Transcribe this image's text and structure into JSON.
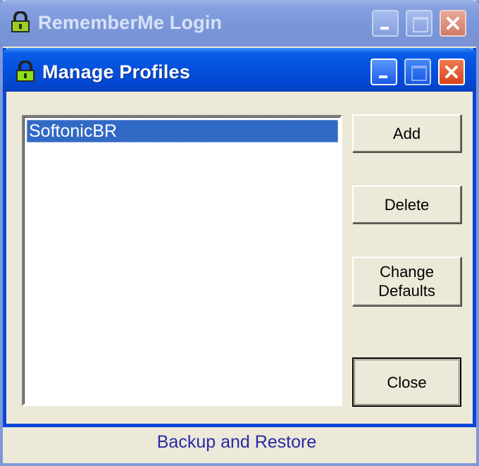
{
  "outer_window": {
    "title": "RememberMe Login",
    "icon": "lock-icon"
  },
  "dialog": {
    "title": "Manage Profiles",
    "icon": "lock-icon"
  },
  "profiles": {
    "items": [
      "SoftonicBR"
    ],
    "selected": "SoftonicBR"
  },
  "buttons": {
    "add": "Add",
    "delete": "Delete",
    "change_defaults_line1": "Change",
    "change_defaults_line2": "Defaults",
    "close": "Close"
  },
  "footer": {
    "link": "Backup and Restore"
  },
  "colors": {
    "titlebar_active": "#0450dc",
    "titlebar_inactive": "#7a96d8",
    "selection": "#316ac5",
    "footer_link": "#2a2aa8"
  }
}
